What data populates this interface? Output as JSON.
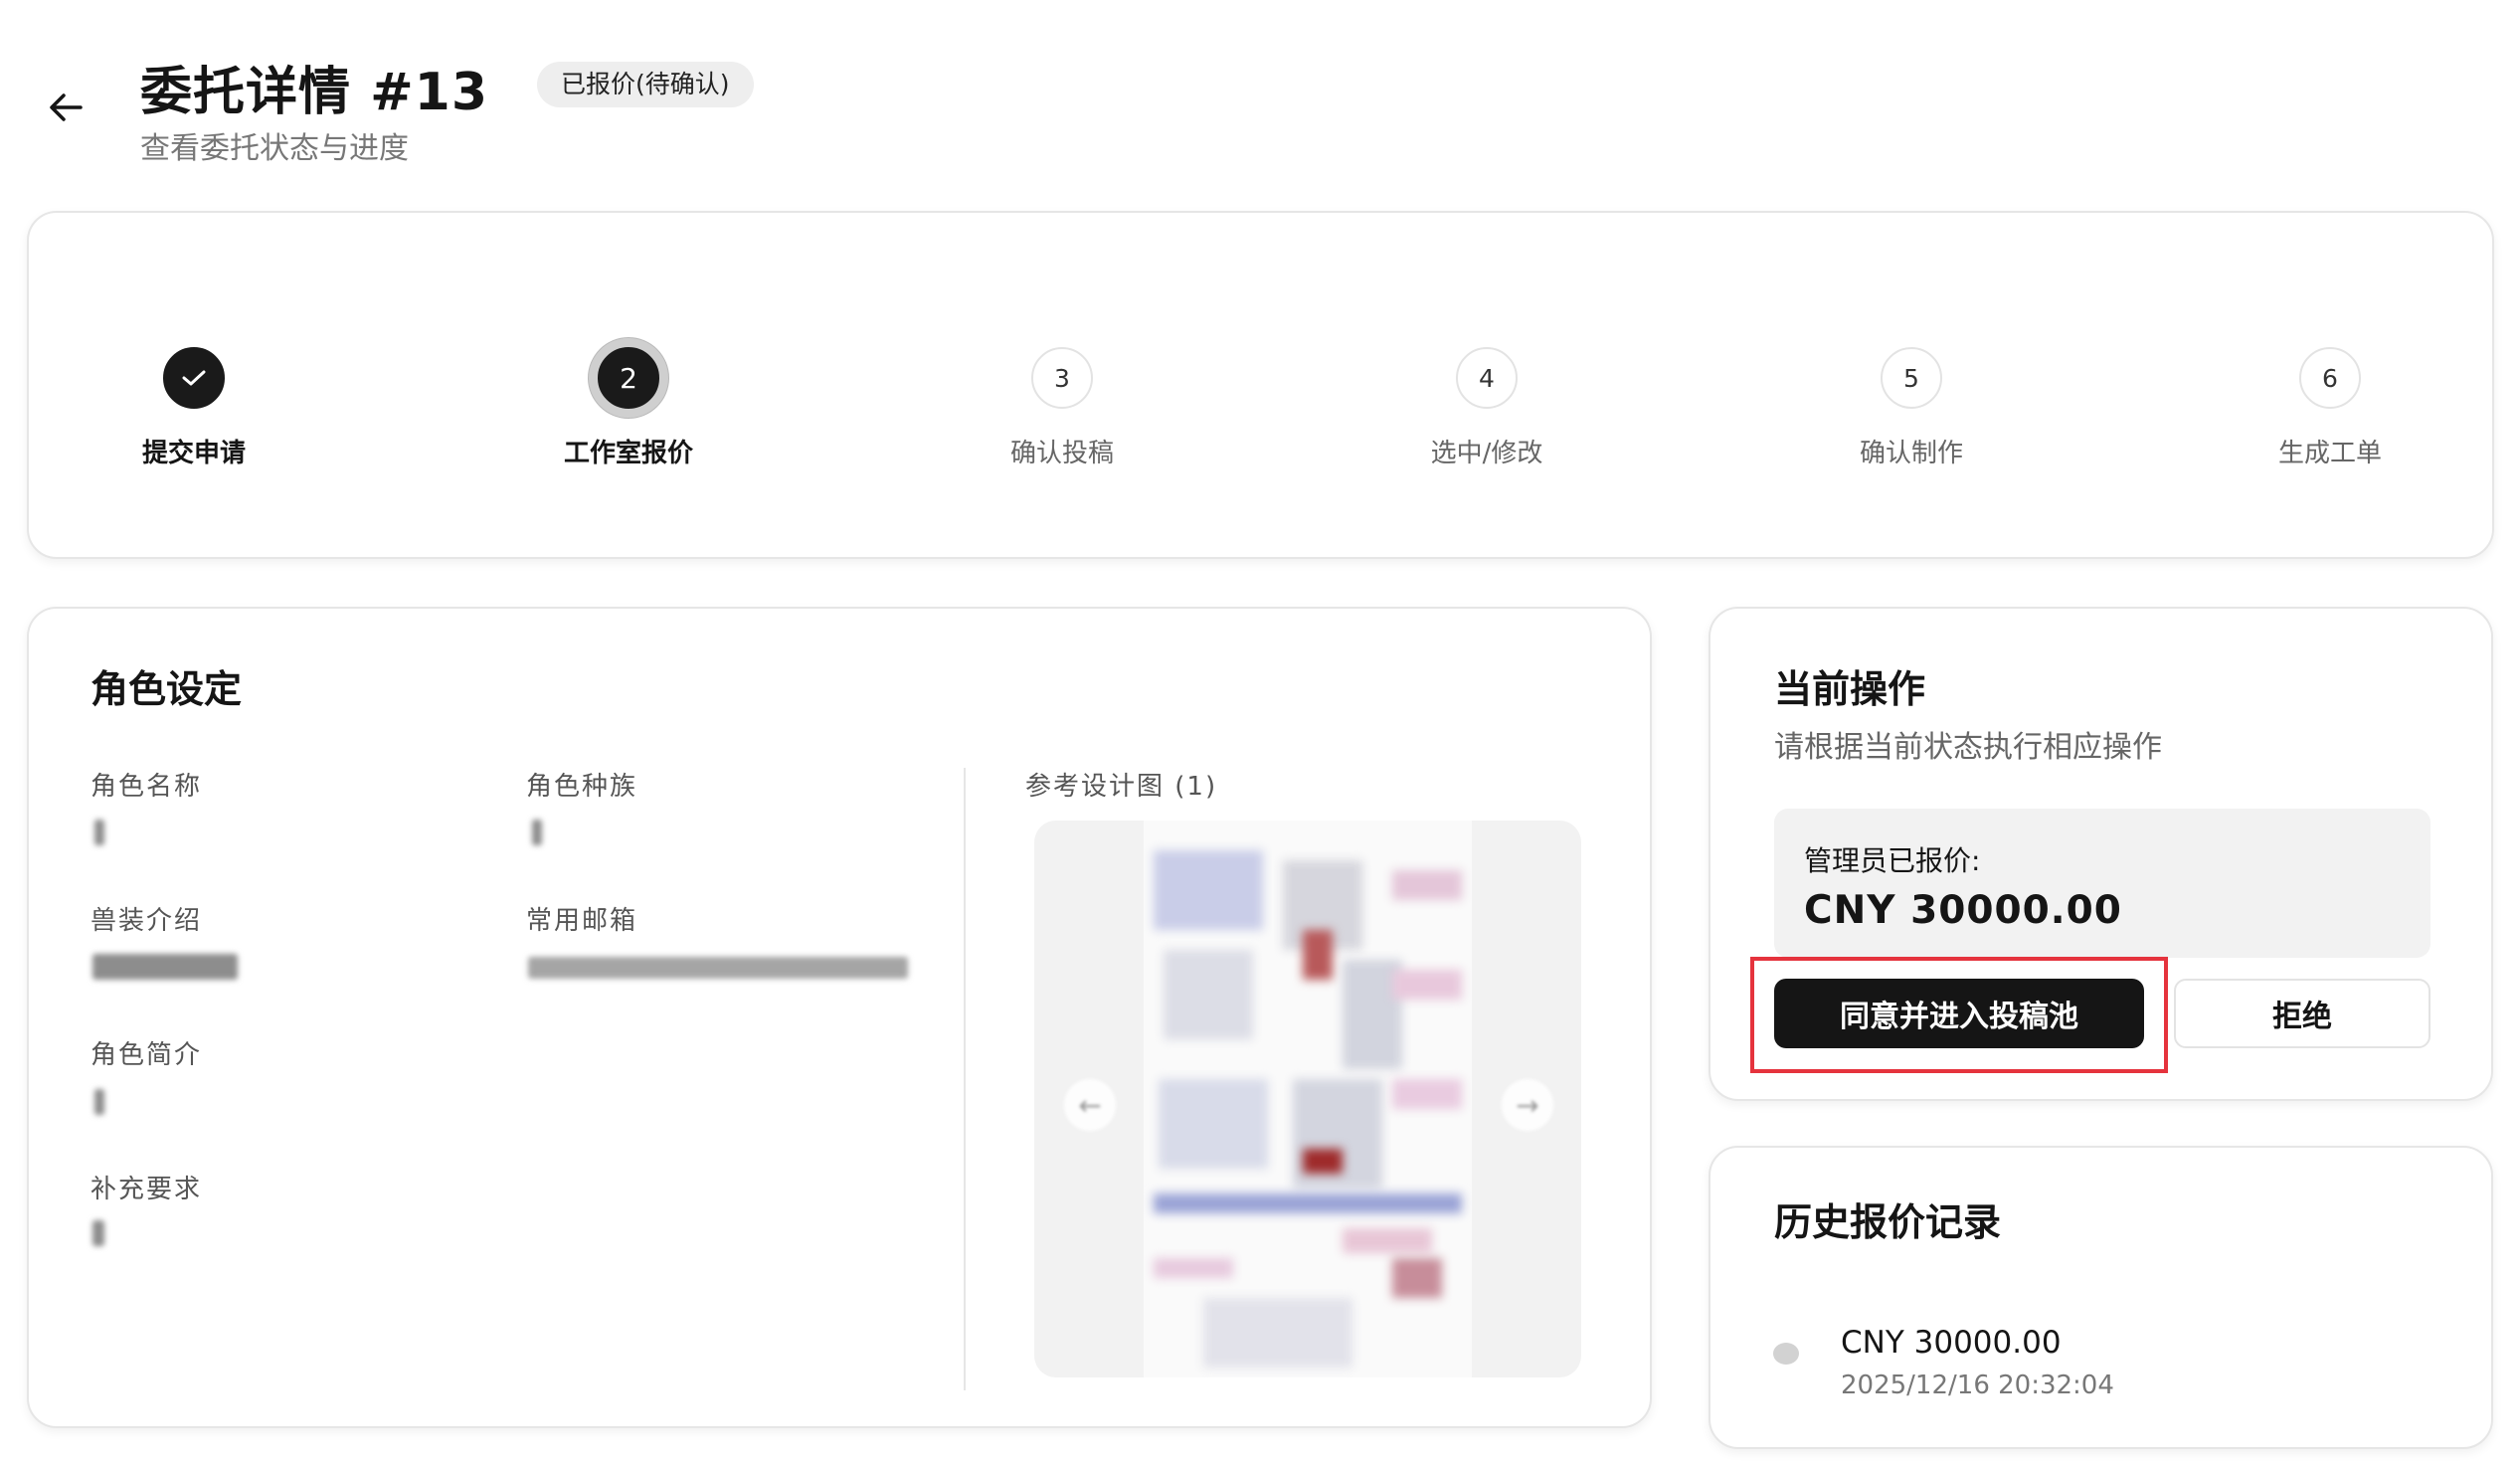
{
  "header": {
    "title": "委托详情 #13",
    "status": "已报价(待确认)",
    "subtitle": "查看委托状态与进度",
    "back_icon": "arrow-left-icon"
  },
  "steps": [
    {
      "label": "提交申请",
      "number": "",
      "state": "done",
      "icon": "check-icon"
    },
    {
      "label": "工作室报价",
      "number": "2",
      "state": "active"
    },
    {
      "label": "确认投稿",
      "number": "3",
      "state": "pending"
    },
    {
      "label": "选中/修改",
      "number": "4",
      "state": "pending"
    },
    {
      "label": "确认制作",
      "number": "5",
      "state": "pending"
    },
    {
      "label": "生成工单",
      "number": "6",
      "state": "pending"
    }
  ],
  "character": {
    "title": "角色设定",
    "fields": {
      "name_label": "角色名称",
      "species_label": "角色种族",
      "costume_label": "兽装介绍",
      "email_label": "常用邮箱",
      "intro_label": "角色简介",
      "extra_label": "补充要求"
    },
    "reference_title": "参考设计图 (1)"
  },
  "action": {
    "title": "当前操作",
    "description": "请根据当前状态执行相应操作",
    "quote_label": "管理员已报价:",
    "quote_amount": "CNY 30000.00",
    "accept_label": "同意并进入投稿池",
    "reject_label": "拒绝",
    "highlight_color": "#e5333d"
  },
  "history": {
    "title": "历史报价记录",
    "items": [
      {
        "amount": "CNY 30000.00",
        "time": "2025/12/16 20:32:04"
      }
    ]
  }
}
